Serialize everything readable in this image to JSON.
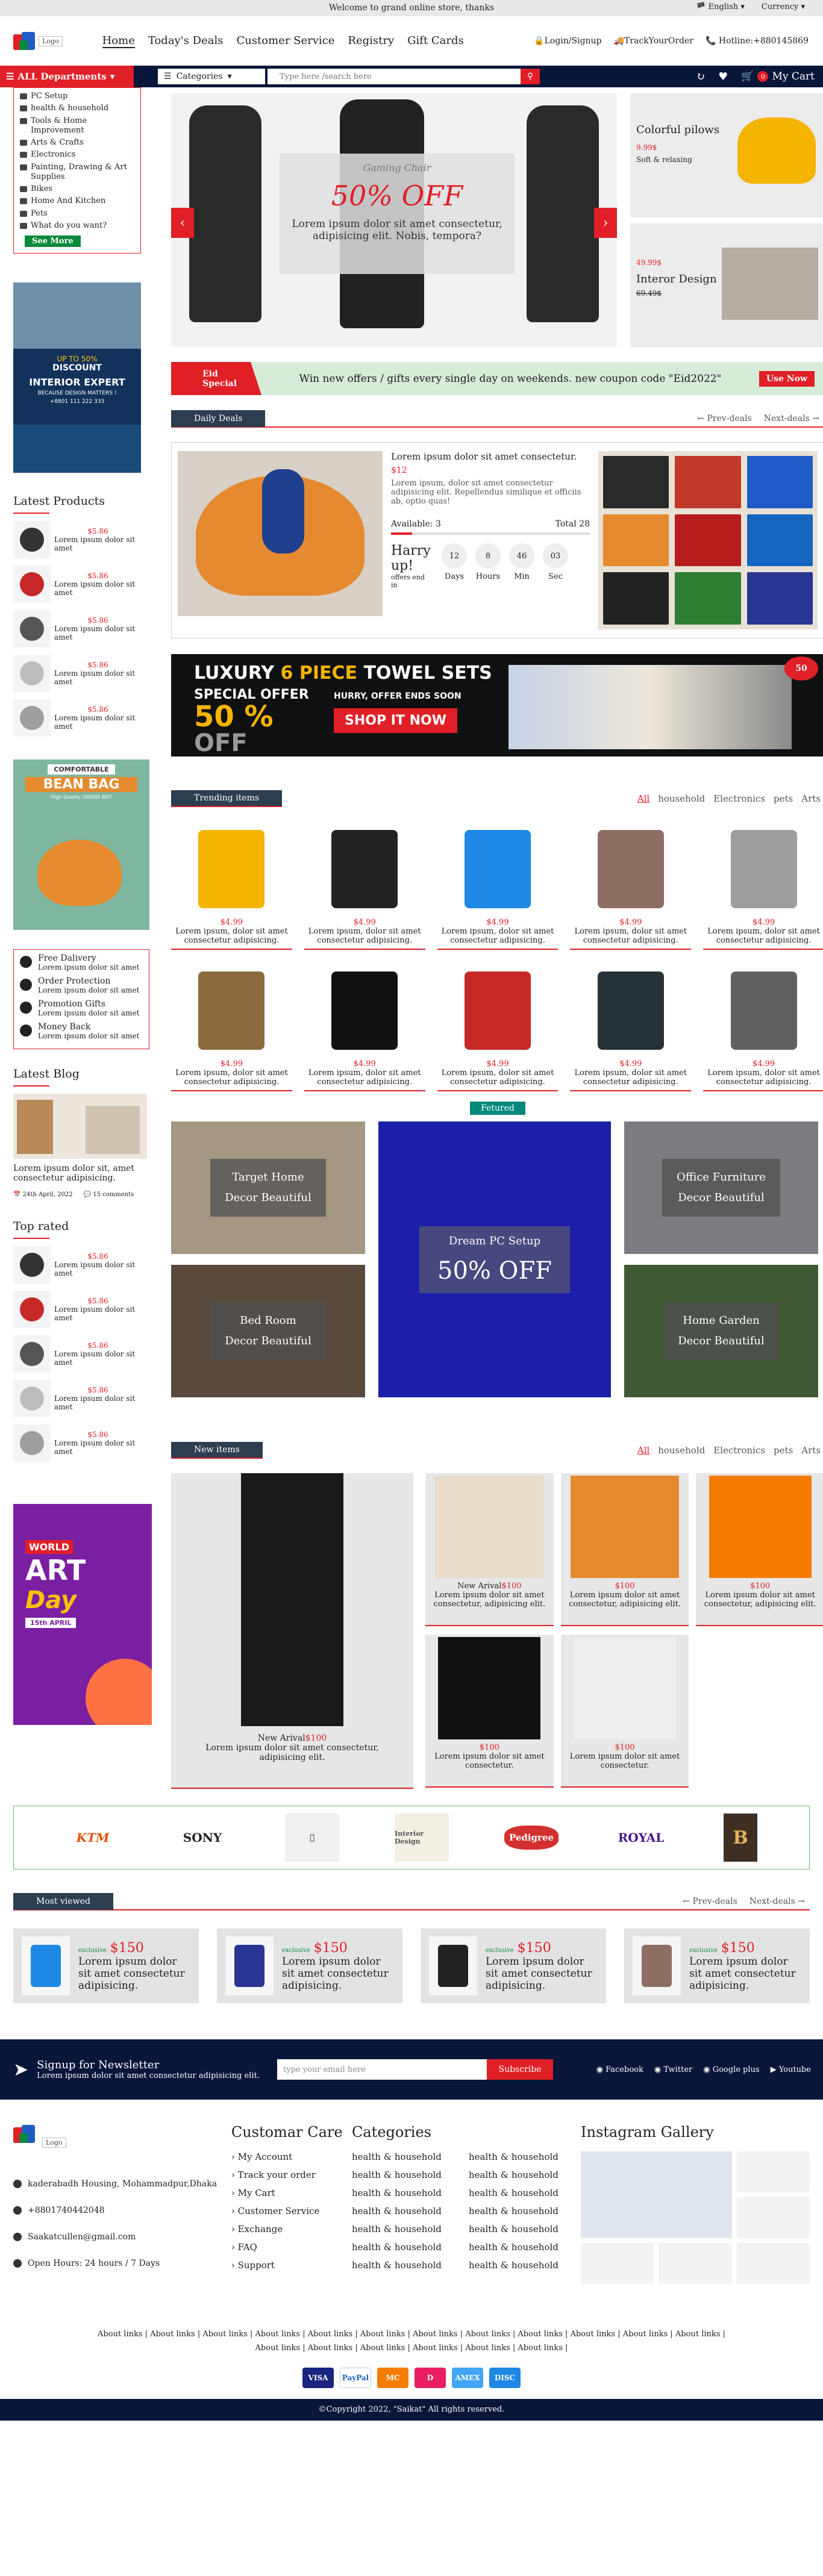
{
  "topbar": {
    "welcome": "Welcome to grand online store, thanks",
    "language": "English",
    "currency": "Currency"
  },
  "header": {
    "logo_text": "Logo",
    "nav": [
      "Home",
      "Today's Deals",
      "Customer Service",
      "Registry",
      "Gift Cards"
    ],
    "login": "Login/Signup",
    "track": "TrackYourOrder",
    "hotline": "Hotline:+880145869"
  },
  "navbar": {
    "all_departments": "ALL Departments",
    "categories": "Categories",
    "search_placeholder": "Type here /search here",
    "cart": "My Cart",
    "cart_count": "0"
  },
  "sidebar": {
    "categories": [
      "PC Setup",
      "health & household",
      "Tools & Home Improvement",
      "Arts & Crafts",
      "Electronics",
      "Painting, Drawing & Art Supplies",
      "Bikes",
      "Home And Kitchen",
      "Pets",
      "What do you want?"
    ],
    "see_more": "See More"
  },
  "promo": {
    "line1": "UP TO 50%",
    "line2": "DISCOUNT",
    "line3": "INTERIOR EXPERT",
    "line4": "BECAUSE DESIGN MATTERS !",
    "phone": "+8801 111 222 333"
  },
  "latest_products": {
    "title": "Latest Products",
    "items": [
      {
        "price": "$5.86",
        "text": "Lorem ipsum dolor sit amet"
      },
      {
        "price": "$5.86",
        "text": "Lorem ipsum dolor sit amet"
      },
      {
        "price": "$5.86",
        "text": "Lorem ipsum dolor sit amet"
      },
      {
        "price": "$5.86",
        "text": "Lorem ipsum dolor sit amet"
      },
      {
        "price": "$5.86",
        "text": "Lorem ipsum dolor sit amet"
      }
    ]
  },
  "beanbag": {
    "title1": "COMFORTABLE",
    "title2": "BEAN BAG",
    "sub": "High Quality 100000 BDT"
  },
  "services": [
    {
      "title": "Free Dalivery",
      "text": "Lorem ipsum dolor sit amet"
    },
    {
      "title": "Order Protection",
      "text": "Lorem ipsum dolor sit amet"
    },
    {
      "title": "Promotion Gifts",
      "text": "Lorem ipsum dolor sit amet"
    },
    {
      "title": "Money Back",
      "text": "Lorem ipsum dolor sit amet"
    }
  ],
  "blog": {
    "title": "Latest Blog",
    "text": "Lorem ipsum dolor sit, amet consectetur adipisicing.",
    "date": "24th April, 2022",
    "comments": "15 comments"
  },
  "top_rated": {
    "title": "Top rated",
    "items": [
      {
        "price": "$5.86",
        "text": "Lorem ipsum dolor sit amet"
      },
      {
        "price": "$5.86",
        "text": "Lorem ipsum dolor sit amet"
      },
      {
        "price": "$5.86",
        "text": "Lorem ipsum dolor sit amet"
      },
      {
        "price": "$5.86",
        "text": "Lorem ipsum dolor sit amet"
      },
      {
        "price": "$5.86",
        "text": "Lorem ipsum dolor sit amet"
      }
    ]
  },
  "artday": {
    "line1": "WORLD",
    "line2": "ART",
    "line3": "Day",
    "date": "15th APRIL"
  },
  "hero": {
    "subtitle": "Gaming Chair",
    "offer": "50% OFF",
    "text": "Lorem ipsum dolor sit amet consectetur, adipisicing elit. Nobis, tempora?"
  },
  "side_banners": [
    {
      "title": "Colorful pilows",
      "price": "9.99$",
      "sub": "Soft & relaxing"
    },
    {
      "title": "Interor Design",
      "price": "49.99$",
      "old": "69.49$"
    }
  ],
  "eid": {
    "label1": "Eid",
    "label2": "Special",
    "message": "Win new offers / gifts every single day on weekends. new coupon code \"Eid2022\"",
    "button": "Use Now"
  },
  "daily_deals": {
    "title": "Daily Deals",
    "prev": "Prev-deals",
    "next": "Next-deals",
    "name": "Lorem ipsum dolor sit amet consectetur.",
    "price": "$12",
    "desc": "Lorem ipsum, dolor sit amet consectetur adipisicing elit. Repellendus similique et officiis ab, optio quas!",
    "available": "Available: 3",
    "total": "Total 28",
    "hurry": "Harry up!",
    "ends": "offers end in",
    "timer": [
      {
        "v": "12",
        "l": "Days"
      },
      {
        "v": "8",
        "l": "Hours"
      },
      {
        "v": "46",
        "l": "Min"
      },
      {
        "v": "03",
        "l": "Sec"
      }
    ],
    "sold_fraction": 0.107
  },
  "towel": {
    "title1": "LUXURY",
    "title2": "6 PIECE",
    "title3": "TOWEL SETS",
    "special": "SPECIAL OFFER",
    "percent": "50 %",
    "off": "OFF",
    "hurry": "HURRY, OFFER ENDS SOON",
    "shop": "SHOP IT NOW",
    "badge": "50"
  },
  "trending": {
    "title": "Trending items",
    "filters": [
      "All",
      "household",
      "Electronics",
      "pets",
      "Arts"
    ],
    "items": [
      {
        "price": "$4.99",
        "text": "Lorem ipsum, dolor sit amet consectetur adipisicing."
      },
      {
        "price": "$4.99",
        "text": "Lorem ipsum, dolor sit amet consectetur adipisicing."
      },
      {
        "price": "$4.99",
        "text": "Lorem ipsum, dolor sit amet consectetur adipisicing."
      },
      {
        "price": "$4.99",
        "text": "Lorem ipsum, dolor sit amet consectetur adipisicing."
      },
      {
        "price": "$4.99",
        "text": "Lorem ipsum, dolor sit amet consectetur adipisicing."
      },
      {
        "price": "$4.99",
        "text": "Lorem ipsum, dolor sit amet consectetur adipisicing."
      },
      {
        "price": "$4.99",
        "text": "Lorem ipsum, dolor sit amet consectetur adipisicing."
      },
      {
        "price": "$4.99",
        "text": "Lorem ipsum, dolor sit amet consectetur adipisicing."
      },
      {
        "price": "$4.99",
        "text": "Lorem ipsum, dolor sit amet consectetur adipisicing."
      },
      {
        "price": "$4.99",
        "text": "Lorem ipsum, dolor sit amet consectetur adipisicing."
      }
    ]
  },
  "featured": {
    "label": "Fetured",
    "tiles": [
      {
        "l1": "Target Home",
        "l2": "Decor Beautiful"
      },
      {
        "l1": "Bed Room",
        "l2": "Decor Beautiful"
      },
      {
        "l1": "Dream PC Setup",
        "l2": "50% OFF"
      },
      {
        "l1": "Office Furniture",
        "l2": "Decor Beautiful"
      },
      {
        "l1": "Home Garden",
        "l2": "Decor Beautiful"
      }
    ]
  },
  "new_items": {
    "title": "New items",
    "filters": [
      "All",
      "household",
      "Electronics",
      "pets",
      "Arts"
    ],
    "big": {
      "tag": "New Arival",
      "price": "$100",
      "text": "Lorem ipsum dolor sit amet consectetur, adipisicing elit."
    },
    "small": [
      {
        "tag": "New Arival",
        "price": "$100",
        "text": "Lorem ipsum dolor sit amet consectetur, adipisicing elit."
      },
      {
        "tag": "",
        "price": "$100",
        "text": "Lorem ipsum dolor sit amet consectetur, adipisicing elit."
      },
      {
        "tag": "",
        "price": "$100",
        "text": "Lorem ipsum dolor sit amet consectetur, adipisicing elit."
      },
      {
        "tag": "",
        "price": "$100",
        "text": "Lorem ipsum dolor sit amet consectetur."
      },
      {
        "tag": "",
        "price": "$100",
        "text": "Lorem ipsum dolor sit amet consectetur."
      }
    ]
  },
  "brands": [
    "KTM",
    "SONY",
    "Apple",
    "Interior Design",
    "Pedigree",
    "ROYAL",
    "B"
  ],
  "most_viewed": {
    "title": "Most viewed",
    "prev": "Prev-deals",
    "next": "Next-deals",
    "items": [
      {
        "tag": "exclusive",
        "price": "$150",
        "text": "Lorem ipsum dolor sit amet consectetur adipisicing."
      },
      {
        "tag": "exclusive",
        "price": "$150",
        "text": "Lorem ipsum dolor sit amet consectetur adipisicing."
      },
      {
        "tag": "exclusive",
        "price": "$150",
        "text": "Lorem ipsum dolor sit amet consectetur adipisicing."
      },
      {
        "tag": "exclusive",
        "price": "$150",
        "text": "Lorem ipsum dolor sit amet consectetur adipisicing."
      }
    ]
  },
  "newsletter": {
    "title": "Signup for Newsletter",
    "sub": "Lorem ipsum dolor sit amet consectetur adipisicing elit.",
    "placeholder": "type your email here",
    "button": "Subscribe",
    "socials": [
      "Facebook",
      "Twitter",
      "Google plus",
      "Youtube"
    ]
  },
  "footer": {
    "address": "kaderabadh Housing, Mohammadpur,Dhaka",
    "phone": "+8801740442048",
    "email": "Saakatcullen@gmail.com",
    "hours": "Open Hours: 24 hours / 7 Days",
    "customer_care_title": "Customar Care",
    "customer_care": [
      "My Account",
      "Track your order",
      "My Cart",
      "Customer Service",
      "Exchange",
      "FAQ",
      "Support"
    ],
    "categories_title": "Categories",
    "categories": [
      "health & household",
      "health & household",
      "health & household",
      "health & household",
      "health & household",
      "health & household",
      "health & household",
      "health & household",
      "health & household",
      "health & household",
      "health & household",
      "health & household",
      "health & household",
      "health & household"
    ],
    "instagram_title": "Instagram Gallery",
    "about_link": "About links",
    "payments": [
      "VISA",
      "PayPal",
      "MC",
      "D",
      "AMEX",
      "DISC"
    ],
    "copyright": "©Copyright 2022, \"Saikat\" All rights reserved."
  },
  "colors": {
    "accent": "#e11f26",
    "navy": "#08163a",
    "green": "#0c8a3a",
    "teal": "#00897b"
  }
}
